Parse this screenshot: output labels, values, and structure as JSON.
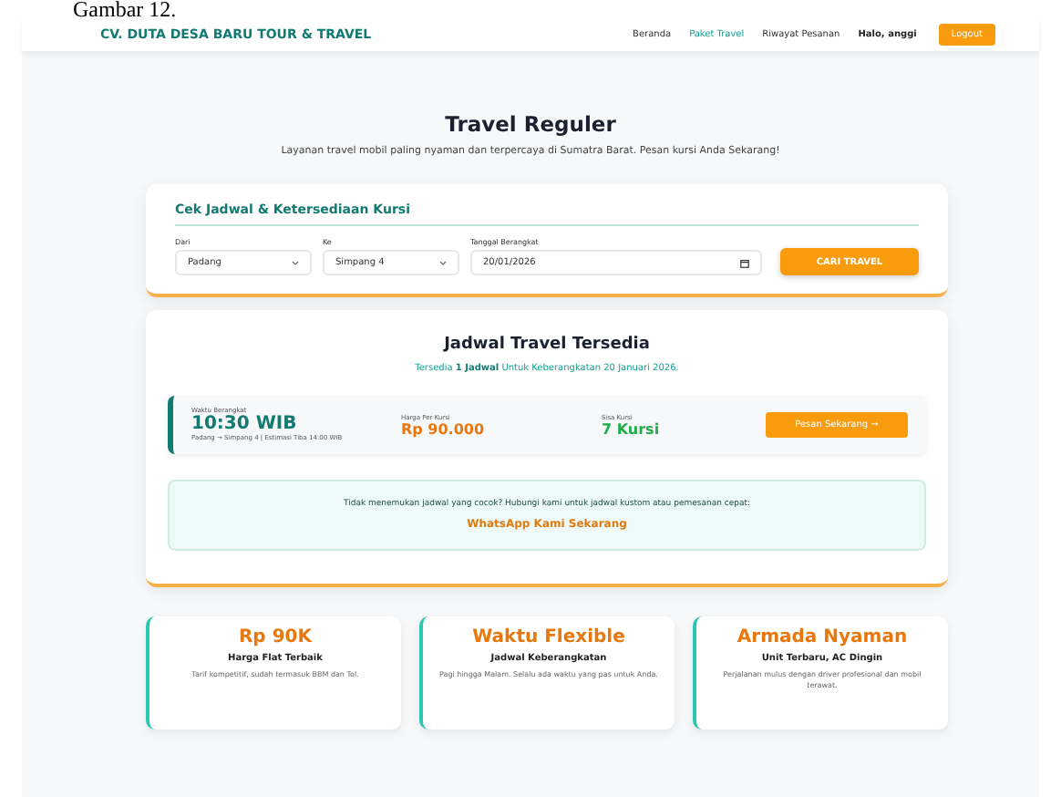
{
  "caption": "Gambar 12.",
  "nav": {
    "brand": "CV. DUTA DESA BARU TOUR & TRAVEL",
    "links": [
      {
        "label": "Beranda",
        "selected": false
      },
      {
        "label": "Paket Travel",
        "selected": true
      },
      {
        "label": "Riwayat Pesanan",
        "selected": false
      }
    ],
    "greeting": "Halo, anggi",
    "logout": "Logout"
  },
  "hero": {
    "title": "Travel Reguler",
    "subtitle": "Layanan travel mobil paling nyaman dan terpercaya di Sumatra Barat. Pesan kursi Anda Sekarang!"
  },
  "search": {
    "title": "Cek Jadwal & Ketersediaan Kursi",
    "fields": [
      {
        "label": "Dari",
        "value": "Padang",
        "kind": "select"
      },
      {
        "label": "Ke",
        "value": "Simpang 4",
        "kind": "select"
      },
      {
        "label": "Tanggal Berangkat",
        "value": "20/01/2026",
        "kind": "date"
      }
    ],
    "button": "CARI TRAVEL"
  },
  "schedule": {
    "title": "Jadwal Travel Tersedia",
    "summary": "Tersedia **1 Jadwal** Untuk Keberangkatan 20 Januari 2026.",
    "trips": [
      {
        "time_label": "Waktu Berangkat",
        "time": "10:30 WIB",
        "route": "Padang → Simpang 4 | Estimasi Tiba 14:00 WIB",
        "price_label": "Harga Per Kursi",
        "price": "Rp 90.000",
        "seats_label": "Sisa Kursi",
        "seats": "7 Kursi",
        "button": "Pesan Sekarang →"
      }
    ],
    "contact": {
      "text": "Tidak menemukan jadwal yang cocok? Hubungi kami untuk jadwal kustom atau pemesanan cepat:",
      "link": "WhatsApp Kami Sekarang"
    }
  },
  "features": [
    {
      "title": "Rp 90K",
      "subtitle": "Harga Flat Terbaik",
      "text": "Tarif kompetitif, sudah termasuk BBM dan Tol."
    },
    {
      "title": "Waktu Flexible",
      "subtitle": "Jadwal Keberangkatan",
      "text": "Pagi hingga Malam. Selalu ada waktu yang pas untuk Anda."
    },
    {
      "title": "Armada Nyaman",
      "subtitle": "Unit Terbaru, AC Dingin",
      "text": "Perjalanan mulus dengan driver profesional dan mobil terawat."
    }
  ]
}
